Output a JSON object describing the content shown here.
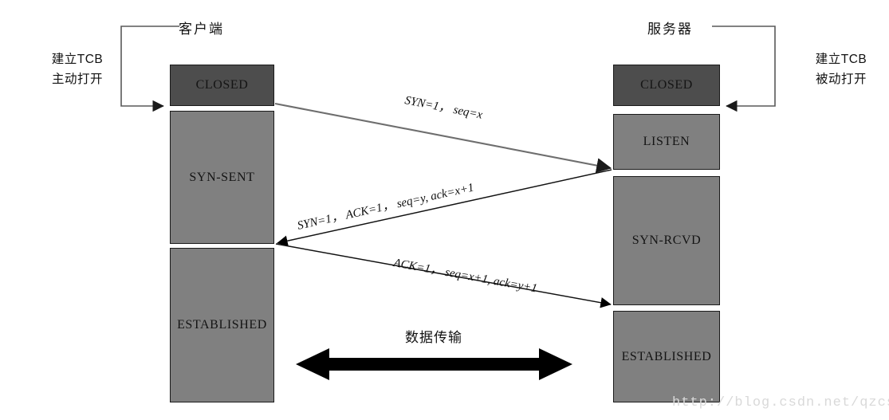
{
  "diagram": {
    "title_client": "客户端",
    "title_server": "服务器",
    "watermark": "http://blog.csdn.net/qzcsu",
    "colors": {
      "closed_box": "#4d4d4d",
      "active_box": "#808080",
      "box_border": "#1a1a1a",
      "line": "#5a5a5a",
      "line_dark": "#000000",
      "text": "#111111",
      "watermark": "#d9d9d9"
    }
  },
  "client": {
    "note": "建立TCB\n主动打开",
    "note_line1": "建立TCB",
    "note_line2": "主动打开",
    "states": [
      {
        "label": "CLOSED",
        "kind": "closed"
      },
      {
        "label": "SYN-SENT",
        "kind": "active"
      },
      {
        "label": "ESTABLISHED",
        "kind": "active"
      }
    ]
  },
  "server": {
    "note_line1": "建立TCB",
    "note_line2": "被动打开",
    "states": [
      {
        "label": "CLOSED",
        "kind": "closed"
      },
      {
        "label": "LISTEN",
        "kind": "active"
      },
      {
        "label": "SYN-RCVD",
        "kind": "active"
      },
      {
        "label": "ESTABLISHED",
        "kind": "active"
      }
    ]
  },
  "messages": [
    {
      "id": "syn",
      "direction": "client-to-server",
      "text": "SYN=1，  seq=x",
      "parts": [
        "SYN=1",
        "seq=x"
      ]
    },
    {
      "id": "syn-ack",
      "direction": "server-to-client",
      "text": "SYN=1，  ACK=1，  seq=y, ack=x+1",
      "parts": [
        "SYN=1",
        "ACK=1",
        "seq=y",
        "ack=x+1"
      ]
    },
    {
      "id": "ack",
      "direction": "client-to-server",
      "text": "ACK=1，  seq=x+1, ack=y+1",
      "parts": [
        "ACK=1",
        "seq=x+1",
        "ack=y+1"
      ]
    }
  ],
  "data_transfer": {
    "label": "数据传输"
  }
}
